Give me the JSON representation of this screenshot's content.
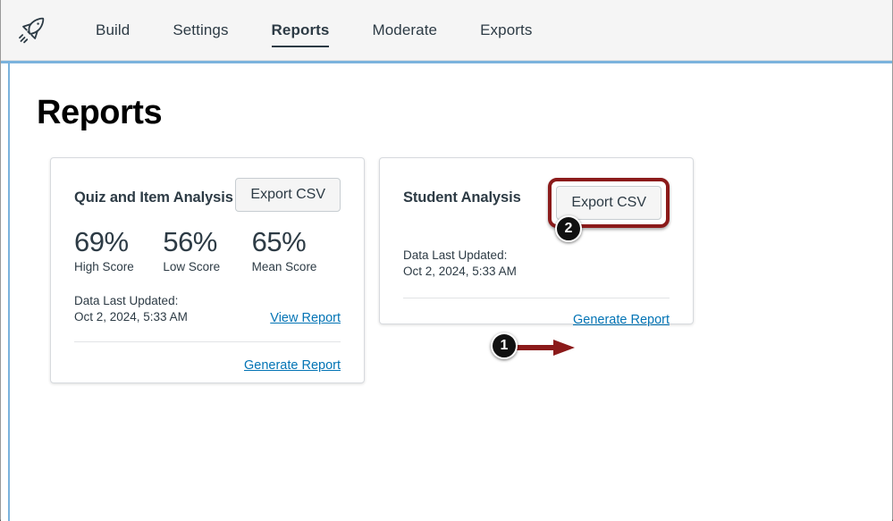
{
  "nav": {
    "logo_icon": "rocket-icon",
    "tabs": [
      {
        "label": "Build",
        "active": false
      },
      {
        "label": "Settings",
        "active": false
      },
      {
        "label": "Reports",
        "active": true
      },
      {
        "label": "Moderate",
        "active": false
      },
      {
        "label": "Exports",
        "active": false
      }
    ]
  },
  "page": {
    "title": "Reports"
  },
  "cards": {
    "quiz_item_analysis": {
      "title": "Quiz and Item Analysis",
      "export_button": "Export CSV",
      "stats": [
        {
          "value": "69%",
          "label": "High Score"
        },
        {
          "value": "56%",
          "label": "Low Score"
        },
        {
          "value": "65%",
          "label": "Mean Score"
        }
      ],
      "data_updated_label": "Data Last Updated:",
      "data_updated_value": "Oct 2, 2024, 5:33 AM",
      "view_report_link": "View Report",
      "generate_report_link": "Generate Report"
    },
    "student_analysis": {
      "title": "Student Analysis",
      "export_button": "Export CSV",
      "data_updated_label": "Data Last Updated:",
      "data_updated_value": "Oct 2, 2024, 5:33 AM",
      "generate_report_link": "Generate Report"
    }
  },
  "annotations": {
    "badge_one": "1",
    "badge_two": "2",
    "highlight_color": "#8b1a1a",
    "badge_color": "#111111"
  },
  "colors": {
    "link": "#0374b5",
    "text": "#2d3b45",
    "nav_background": "#f5f5f5",
    "content_border": "#7bb3dd"
  }
}
